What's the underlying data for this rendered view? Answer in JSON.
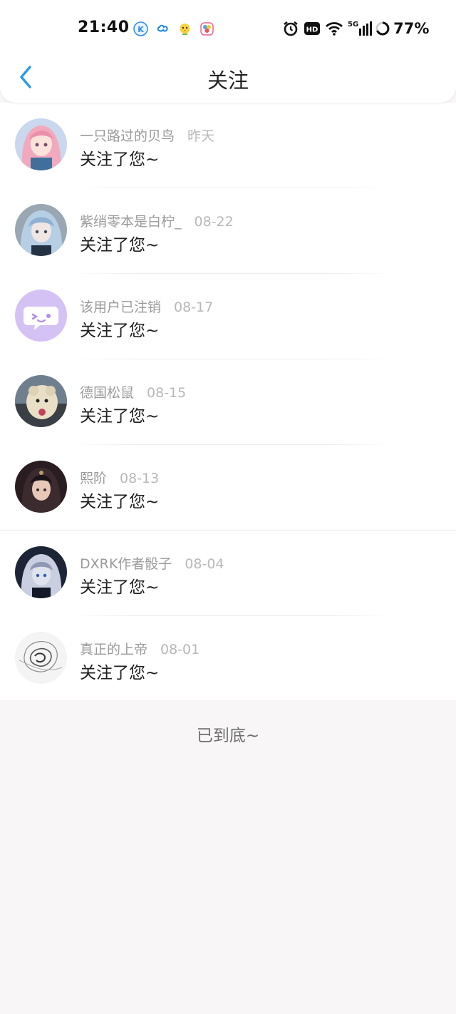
{
  "status_bar": {
    "time": "21:40",
    "battery": "77%",
    "network": "5G"
  },
  "header": {
    "title": "关注"
  },
  "notifications": [
    {
      "name": "一只路过的贝鸟",
      "date": "昨天",
      "message": "关注了您~"
    },
    {
      "name": "紫绡零本是白柠_",
      "date": "08-22",
      "message": "关注了您~"
    },
    {
      "name": "该用户已注销",
      "date": "08-17",
      "message": "关注了您~"
    },
    {
      "name": "德国松鼠",
      "date": "08-15",
      "message": "关注了您~"
    },
    {
      "name": "熙阶",
      "date": "08-13",
      "message": "关注了您~"
    },
    {
      "name": "DXRK作者骰子",
      "date": "08-04",
      "message": "关注了您~"
    },
    {
      "name": "真正的上帝",
      "date": "08-01",
      "message": "关注了您~"
    }
  ],
  "footer": {
    "end_text": "已到底~"
  },
  "colors": {
    "accent": "#2b9be8",
    "background": "#f8f6f7",
    "deleted_user_avatar": "#d5c2f5"
  }
}
